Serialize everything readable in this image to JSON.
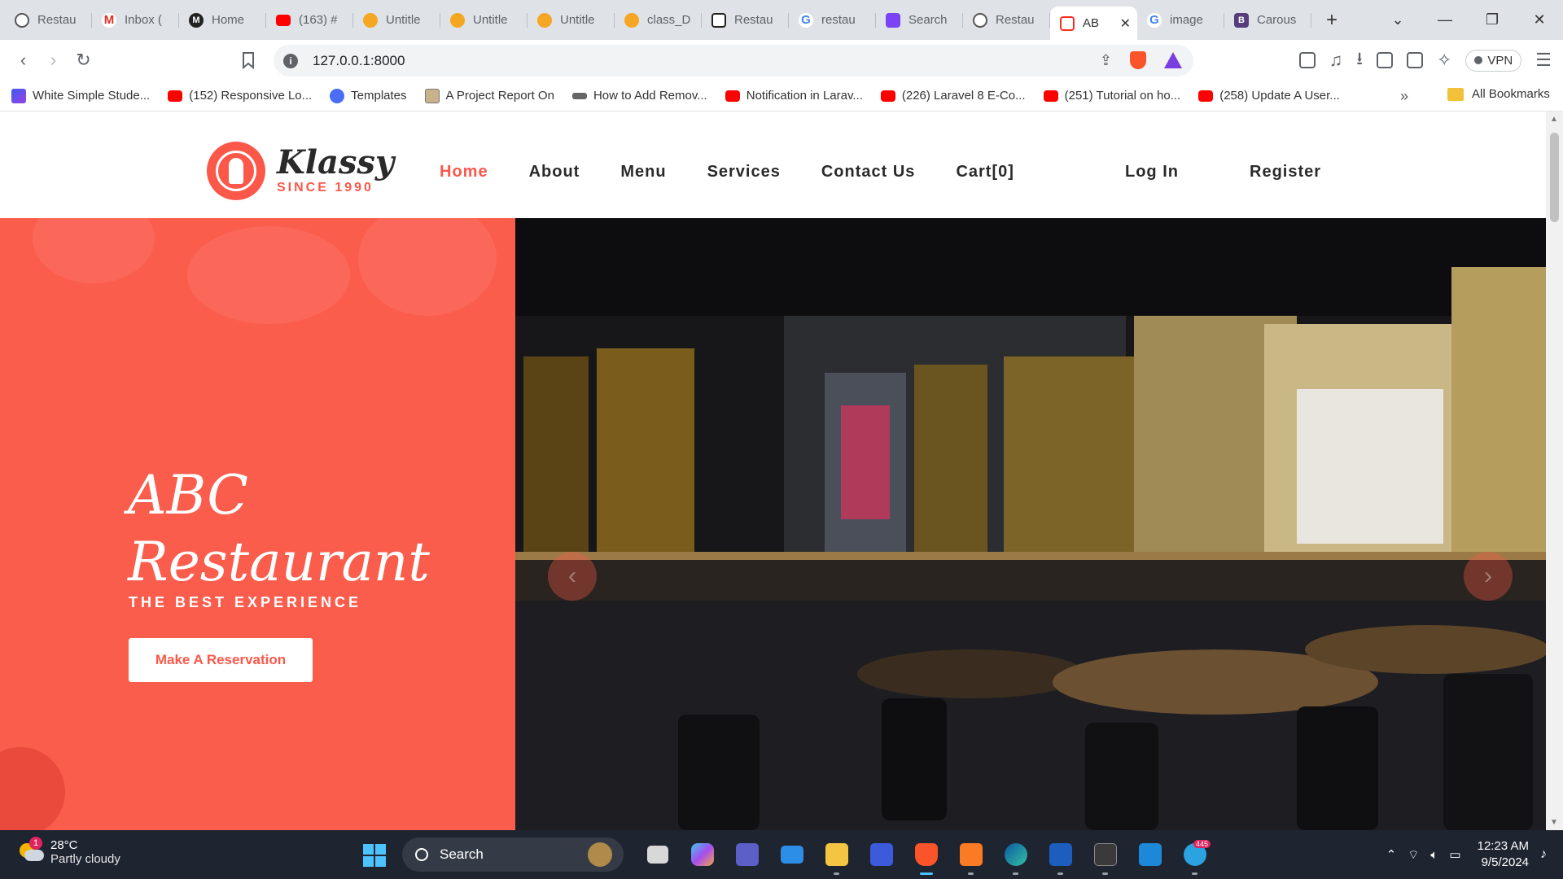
{
  "browser": {
    "tabs": [
      {
        "title": "Restau",
        "icon": "chatgpt-icon",
        "fav": "fav-gpt"
      },
      {
        "title": "Inbox (",
        "icon": "gmail-icon",
        "fav": "fav-gmail",
        "glyph": "M"
      },
      {
        "title": "Home",
        "icon": "medium-icon",
        "fav": "fav-medium",
        "glyph": "M"
      },
      {
        "title": "(163) #",
        "icon": "youtube-icon",
        "fav": "fav-yt"
      },
      {
        "title": "Untitle",
        "icon": "monday-icon",
        "fav": "fav-mon"
      },
      {
        "title": "Untitle",
        "icon": "monday-icon",
        "fav": "fav-mon"
      },
      {
        "title": "Untitle",
        "icon": "monday-icon",
        "fav": "fav-mon"
      },
      {
        "title": "class_D",
        "icon": "monday-icon",
        "fav": "fav-mon"
      },
      {
        "title": "Restau",
        "icon": "codeforces-icon",
        "fav": "fav-cf"
      },
      {
        "title": "restau",
        "icon": "google-icon",
        "fav": "fav-g",
        "glyph": "G"
      },
      {
        "title": "Search",
        "icon": "search-app-icon",
        "fav": "fav-srch"
      },
      {
        "title": "Restau",
        "icon": "chatgpt-icon",
        "fav": "fav-gpt"
      },
      {
        "title": "AB",
        "icon": "laravel-icon",
        "fav": "fav-lar",
        "active": true
      },
      {
        "title": "image",
        "icon": "google-icon",
        "fav": "fav-g",
        "glyph": "G"
      },
      {
        "title": "Carous",
        "icon": "bootstrap-icon",
        "fav": "fav-bs",
        "glyph": "B"
      }
    ],
    "new_tab_glyph": "+",
    "window_controls": {
      "dropdown": "⌄",
      "minimize": "—",
      "restore": "❐",
      "close": "✕"
    },
    "url": "127.0.0.1:8000",
    "vpn_label": "VPN",
    "bookmarks": [
      {
        "label": "White Simple Stude...",
        "icon": "bic-ws"
      },
      {
        "label": "(152) Responsive Lo...",
        "icon": "bic-yt"
      },
      {
        "label": "Templates",
        "icon": "bic-c"
      },
      {
        "label": "A Project Report On",
        "icon": "bic-pr"
      },
      {
        "label": "How to Add Remov...",
        "icon": "bic-wp"
      },
      {
        "label": "Notification in Larav...",
        "icon": "bic-yt"
      },
      {
        "label": "(226) Laravel 8 E-Co...",
        "icon": "bic-yt"
      },
      {
        "label": "(251) Tutorial on ho...",
        "icon": "bic-yt"
      },
      {
        "label": "(258) Update A User...",
        "icon": "bic-yt"
      }
    ],
    "bookmarks_more": "»",
    "all_bookmarks": "All Bookmarks"
  },
  "site": {
    "logo_name": "Klassy",
    "logo_since": "SINCE 1990",
    "nav": [
      {
        "label": "Home",
        "active": true
      },
      {
        "label": "About"
      },
      {
        "label": "Menu"
      },
      {
        "label": "Services"
      },
      {
        "label": "Contact Us"
      },
      {
        "label": "Cart[0]"
      }
    ],
    "login": "Log In",
    "register": "Register",
    "hero": {
      "title_line1": "ABC",
      "title_line2": "Restaurant",
      "subtitle": "THE BEST EXPERIENCE",
      "cta": "Make A Reservation"
    },
    "carousel": {
      "prev": "‹",
      "next": "›"
    }
  },
  "taskbar": {
    "weather_badge": "1",
    "temperature": "28°C",
    "condition": "Partly cloudy",
    "search_placeholder": "Search",
    "telegram_count": "445",
    "time": "12:23 AM",
    "date": "9/5/2024"
  },
  "colors": {
    "accent": "#fb5849",
    "hero_bg": "#fb5d4d",
    "taskbar": "#1f2431"
  }
}
